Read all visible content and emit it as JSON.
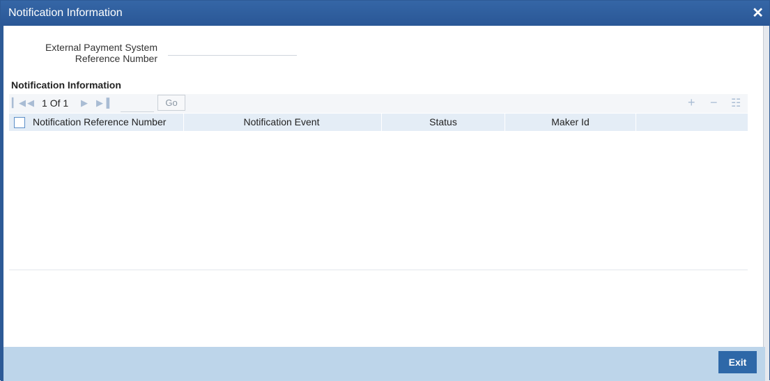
{
  "dialog": {
    "title": "Notification Information",
    "close_symbol": "✕"
  },
  "form": {
    "ext_ref_label_line1": "External Payment System",
    "ext_ref_label_line2": "Reference Number",
    "ext_ref_value": ""
  },
  "section": {
    "title": "Notification Information"
  },
  "pagination": {
    "current": "1",
    "of_label": "Of",
    "total": "1",
    "page_input": "",
    "go_label": "Go"
  },
  "grid": {
    "columns": [
      "Notification Reference Number",
      "Notification Event",
      "Status",
      "Maker Id"
    ],
    "rows": []
  },
  "toolbar_icons": [
    "first-page-icon",
    "prev-page-icon",
    "next-page-icon",
    "last-page-icon",
    "add-row-icon",
    "delete-row-icon",
    "single-view-icon"
  ],
  "footer": {
    "exit_label": "Exit"
  },
  "colors": {
    "titlebar": "#2e5f9f",
    "header_row": "#e4edf6",
    "footer": "#bdd5ea",
    "exit_button": "#2e68a8"
  }
}
